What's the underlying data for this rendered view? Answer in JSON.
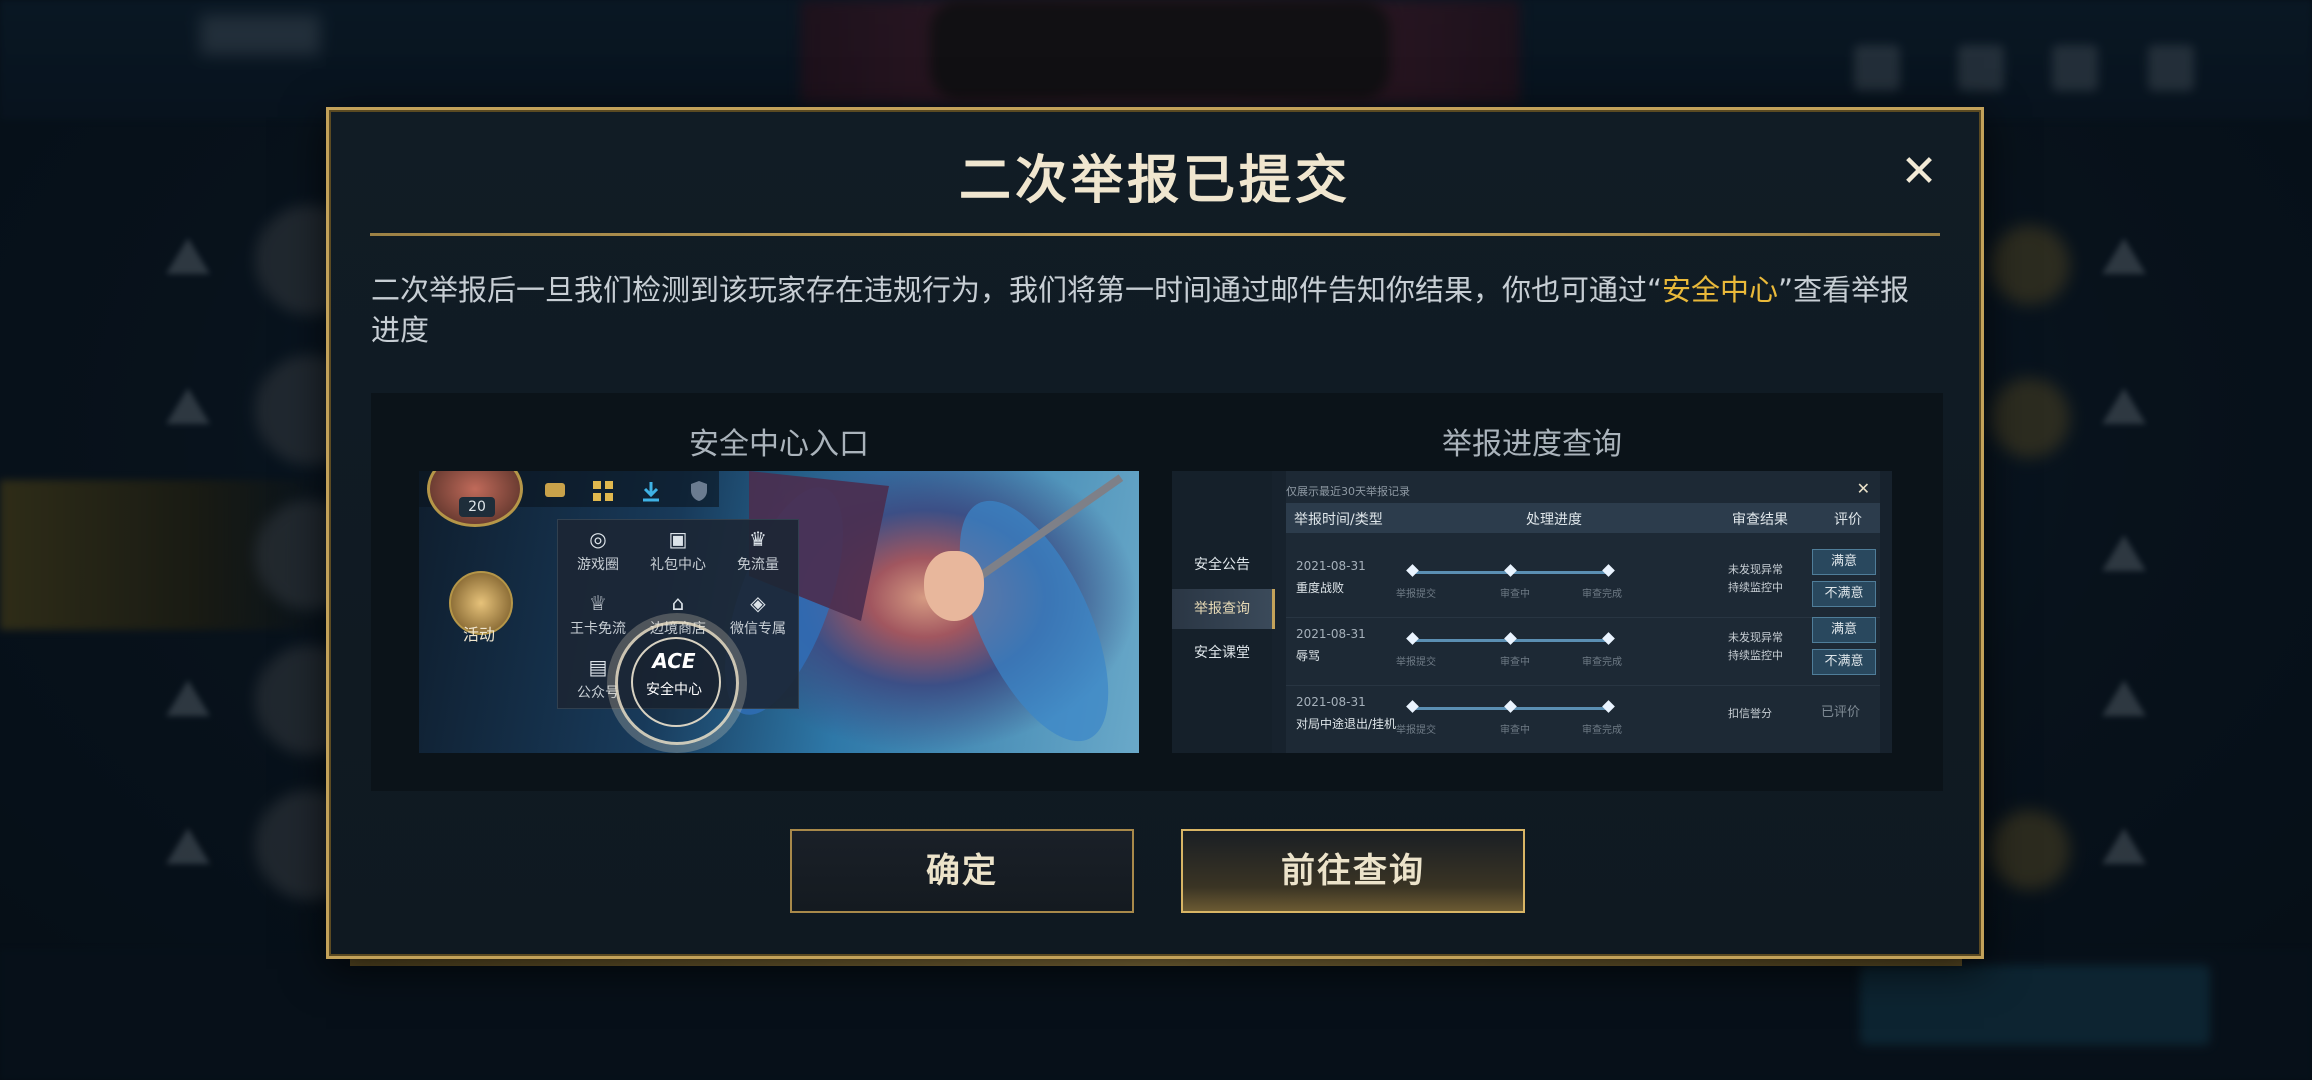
{
  "dialog": {
    "title": "二次举报已提交",
    "close_symbol": "✕",
    "message_prefix": "二次举报后一旦我们检测到该玩家存在违规行为，我们将第一时间通过邮件告知你结果，你也可通过“",
    "message_highlight": "安全中心",
    "message_suffix": "”查看举报进度",
    "colors": {
      "accent": "#c3a25a",
      "highlight": "#e9b93a"
    }
  },
  "guide": {
    "left_label": "安全中心入口",
    "right_label": "举报进度查询",
    "entry_shot": {
      "level": "20",
      "activity_label": "活动",
      "menu_items": [
        {
          "icon": "game-circle-icon",
          "label": "游戏圈"
        },
        {
          "icon": "gift-icon",
          "label": "礼包中心"
        },
        {
          "icon": "crown-icon",
          "label": "免流量"
        },
        {
          "icon": "king-card-icon",
          "label": "王卡免流"
        },
        {
          "icon": "rank-icon",
          "label": "边境商店"
        },
        {
          "icon": "wechat-icon",
          "label": "微信专属"
        },
        {
          "icon": "official-account-icon",
          "label": "公众号"
        }
      ],
      "safety_center_logo": "ACE",
      "safety_center_label": "安全中心"
    },
    "progress_shot": {
      "note": "仅展示最近30天举报记录",
      "close_symbol": "✕",
      "sidebar": [
        "安全公告",
        "举报查询",
        "安全课堂"
      ],
      "headers": [
        "举报时间/类型",
        "处理进度",
        "审查结果",
        "评价"
      ],
      "steps": [
        "举报提交",
        "审查中",
        "审查完成"
      ],
      "rows": [
        {
          "date": "2021-08-31",
          "type": "重度战败",
          "result": [
            "未发现异常",
            "持续监控中"
          ],
          "actions": [
            "满意",
            "不满意"
          ]
        },
        {
          "date": "2021-08-31",
          "type": "辱骂",
          "result": [
            "未发现异常",
            "持续监控中"
          ],
          "actions": [
            "满意",
            "不满意"
          ]
        },
        {
          "date": "2021-08-31",
          "type": "对局中途退出/挂机",
          "result": [
            "扣信誉分"
          ],
          "rated": "已评价"
        }
      ]
    }
  },
  "buttons": {
    "confirm": "确定",
    "go_query": "前往查询"
  }
}
